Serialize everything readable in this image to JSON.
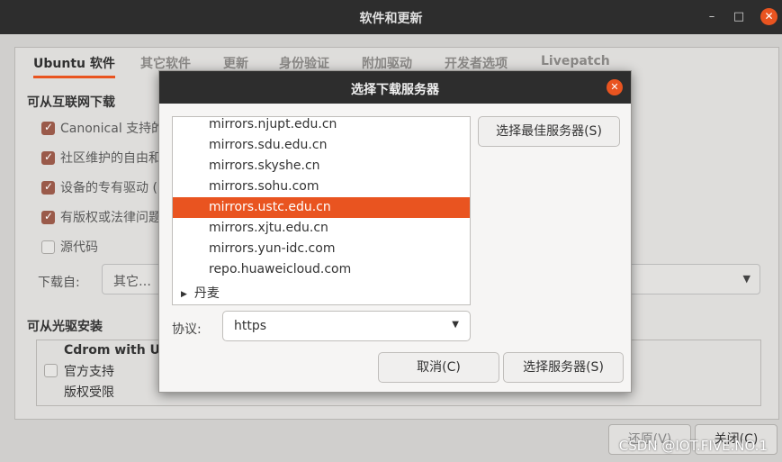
{
  "window": {
    "title": "软件和更新",
    "controls": {
      "minimize": "–",
      "maximize": "□",
      "close": "✕"
    }
  },
  "tabs": [
    "Ubuntu 软件",
    "其它软件",
    "更新",
    "身份验证",
    "附加驱动",
    "开发者选项",
    "Livepatch"
  ],
  "internet_section": {
    "heading": "可从互联网下载",
    "options": [
      {
        "label": "Canonical 支持的",
        "checked": true
      },
      {
        "label": "社区维护的自由和",
        "checked": true
      },
      {
        "label": "设备的专有驱动 (",
        "checked": true
      },
      {
        "label": "有版权或法律问题",
        "checked": true
      },
      {
        "label": "源代码",
        "checked": false
      }
    ],
    "download_from_label": "下载自:",
    "download_from_value": "其它…"
  },
  "cdrom_section": {
    "heading": "可从光驱安装",
    "name": "Cdrom with Ubu",
    "lines": [
      "官方支持",
      "版权受限"
    ]
  },
  "bottom_buttons": {
    "revert": "还原(V)",
    "close": "关闭(C)"
  },
  "watermark": "CSDN @IOT.FIVE.NO.1",
  "dialog": {
    "title": "选择下载服务器",
    "mirrors": [
      "mirrors.njupt.edu.cn",
      "mirrors.sdu.edu.cn",
      "mirrors.skyshe.cn",
      "mirrors.sohu.com",
      "mirrors.ustc.edu.cn",
      "mirrors.xjtu.edu.cn",
      "mirrors.yun-idc.com",
      "repo.huaweicloud.com"
    ],
    "selected_mirror": "mirrors.ustc.edu.cn",
    "country_node": "丹麦",
    "best_server_button": "选择最佳服务器(S)",
    "protocol_label": "协议:",
    "protocol_value": "https",
    "cancel_button": "取消(C)",
    "choose_button": "选择服务器(S)"
  },
  "colors": {
    "accent": "#e95420",
    "titlebar": "#2d2d2d"
  }
}
